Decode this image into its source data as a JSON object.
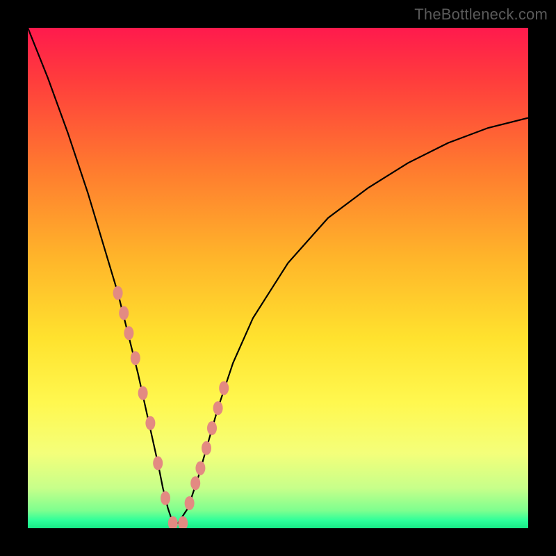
{
  "watermark": {
    "text": "TheBottleneck.com"
  },
  "chart_data": {
    "type": "line",
    "title": "",
    "xlabel": "",
    "ylabel": "",
    "xlim": [
      0,
      100
    ],
    "ylim": [
      0,
      100
    ],
    "series": [
      {
        "name": "bottleneck-curve",
        "x": [
          0,
          4,
          8,
          12,
          15,
          18,
          20,
          22,
          24,
          26,
          27,
          28,
          29,
          30,
          32,
          34,
          36,
          38,
          41,
          45,
          52,
          60,
          68,
          76,
          84,
          92,
          100
        ],
        "values": [
          100,
          90,
          79,
          67,
          57,
          47,
          39,
          31,
          22,
          13,
          8,
          4,
          1,
          1,
          4,
          10,
          17,
          24,
          33,
          42,
          53,
          62,
          68,
          73,
          77,
          80,
          82
        ]
      }
    ],
    "markers": {
      "name": "highlight-dots",
      "color": "#e38a82",
      "x": [
        18,
        19.2,
        20.2,
        21.5,
        23,
        24.5,
        26,
        27.5,
        29,
        31,
        32.3,
        33.5,
        34.5,
        35.7,
        36.8,
        38,
        39.2
      ],
      "values": [
        47,
        43,
        39,
        34,
        27,
        21,
        13,
        6,
        1,
        1,
        5,
        9,
        12,
        16,
        20,
        24,
        28
      ]
    },
    "gradient_stops": [
      {
        "offset": 0.0,
        "color": "#ff1a4d"
      },
      {
        "offset": 0.1,
        "color": "#ff3b3d"
      },
      {
        "offset": 0.28,
        "color": "#ff7a2f"
      },
      {
        "offset": 0.46,
        "color": "#ffb52a"
      },
      {
        "offset": 0.62,
        "color": "#ffe22e"
      },
      {
        "offset": 0.75,
        "color": "#fff84f"
      },
      {
        "offset": 0.85,
        "color": "#f4ff7a"
      },
      {
        "offset": 0.92,
        "color": "#c7ff8a"
      },
      {
        "offset": 0.965,
        "color": "#7dff8f"
      },
      {
        "offset": 0.985,
        "color": "#2cff9a"
      },
      {
        "offset": 1.0,
        "color": "#17e886"
      }
    ]
  }
}
